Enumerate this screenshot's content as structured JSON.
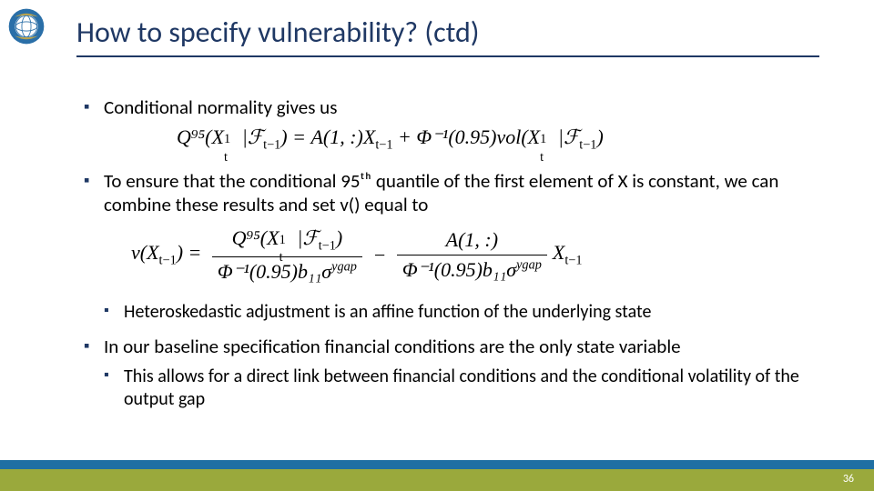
{
  "title": "How to specify vulnerability? (ctd)",
  "bullets": {
    "b1": "Conditional normality gives us",
    "b2": "To ensure that the conditional 95ᵗʰ quantile of the first element of X is constant, we can combine these results and set v() equal to",
    "b2s": "Heteroskedastic adjustment is an affine function of the underlying state",
    "b3": "In our baseline specification financial conditions are the only state variable",
    "b3s": "This allows for a direct link between financial conditions and the conditional volatility of the output gap"
  },
  "formulas": {
    "eq1_lhs": "Q⁹⁵(X",
    "eq1_rhs_a": "A(1, :)X",
    "eq1_rhs_b": "Φ⁻¹(0.95)vol(X",
    "eq2_lhs": "v(X",
    "eq2_num1": "Q⁹⁵(X",
    "eq2_den": "Φ⁻¹(0.95)b₁₁σ",
    "eq2_num2": "A(1, :)",
    "eq2_tail": "X"
  },
  "page": "36"
}
